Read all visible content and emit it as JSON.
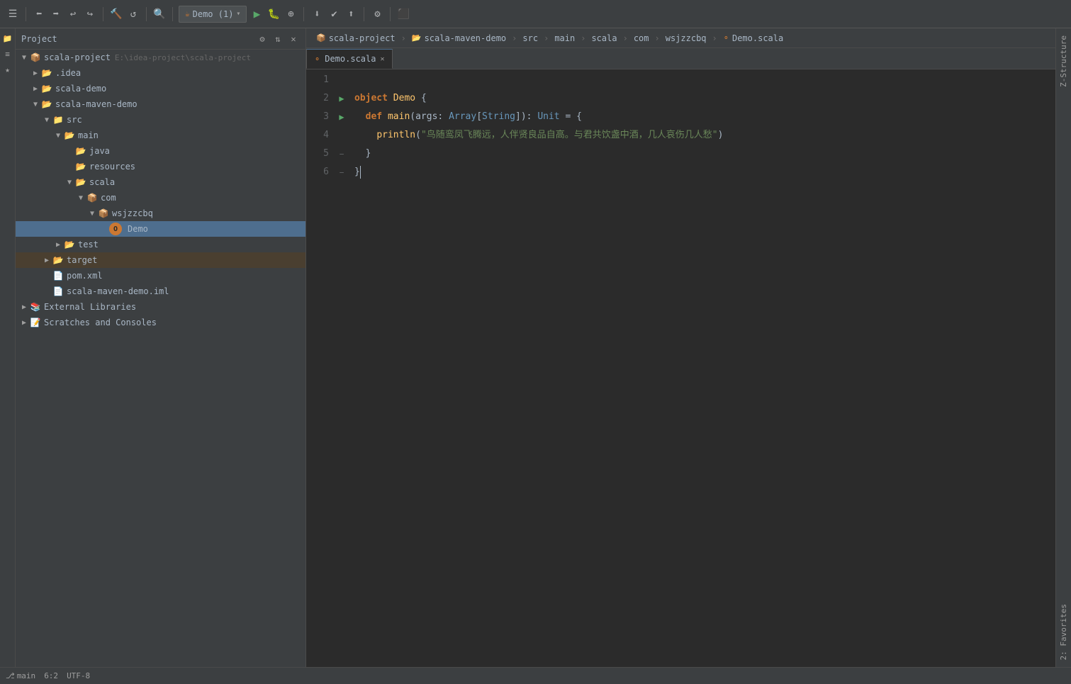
{
  "toolbar": {
    "run_config": "Demo (1)",
    "icons": [
      "☰",
      "⚲",
      "↺",
      "←",
      "→",
      "⊘",
      "✎",
      "⚡",
      "▶",
      "⬛",
      "⟳",
      "⚙",
      "⛃",
      "▷",
      "⚑"
    ],
    "run_label": "Demo (1)"
  },
  "breadcrumb": {
    "items": [
      "scala-project",
      "scala-maven-demo",
      "src",
      "main",
      "scala",
      "com",
      "wsjzzcbq",
      "Demo.scala"
    ]
  },
  "sidebar": {
    "title": "Project",
    "tree": [
      {
        "id": "scala-project",
        "label": "scala-project",
        "sublabel": "E:\\idea-project\\scala-project",
        "indent": 0,
        "type": "root",
        "expanded": true,
        "arrow": "▼"
      },
      {
        "id": "idea",
        "label": ".idea",
        "indent": 1,
        "type": "folder",
        "expanded": false,
        "arrow": "▶"
      },
      {
        "id": "scala-demo",
        "label": "scala-demo",
        "indent": 1,
        "type": "module",
        "expanded": false,
        "arrow": "▶"
      },
      {
        "id": "scala-maven-demo",
        "label": "scala-maven-demo",
        "indent": 1,
        "type": "module",
        "expanded": true,
        "arrow": "▼"
      },
      {
        "id": "src",
        "label": "src",
        "indent": 2,
        "type": "src-folder",
        "expanded": true,
        "arrow": "▼"
      },
      {
        "id": "main",
        "label": "main",
        "indent": 3,
        "type": "folder",
        "expanded": true,
        "arrow": "▼"
      },
      {
        "id": "java",
        "label": "java",
        "indent": 4,
        "type": "folder",
        "expanded": false,
        "arrow": ""
      },
      {
        "id": "resources",
        "label": "resources",
        "indent": 4,
        "type": "folder",
        "expanded": false,
        "arrow": ""
      },
      {
        "id": "scala",
        "label": "scala",
        "indent": 4,
        "type": "folder",
        "expanded": true,
        "arrow": "▼"
      },
      {
        "id": "com",
        "label": "com",
        "indent": 5,
        "type": "package",
        "expanded": true,
        "arrow": "▼"
      },
      {
        "id": "wsjzzcbq",
        "label": "wsjzzcbq",
        "indent": 6,
        "type": "package",
        "expanded": true,
        "arrow": "▼"
      },
      {
        "id": "Demo",
        "label": "Demo",
        "indent": 7,
        "type": "scala-class",
        "selected": true
      },
      {
        "id": "test",
        "label": "test",
        "indent": 3,
        "type": "folder",
        "expanded": false,
        "arrow": "▶"
      },
      {
        "id": "target",
        "label": "target",
        "indent": 2,
        "type": "folder",
        "expanded": false,
        "arrow": "▶"
      },
      {
        "id": "pom.xml",
        "label": "pom.xml",
        "indent": 2,
        "type": "xml"
      },
      {
        "id": "scala-maven-demo.iml",
        "label": "scala-maven-demo.iml",
        "indent": 2,
        "type": "iml"
      },
      {
        "id": "external-libraries",
        "label": "External Libraries",
        "indent": 0,
        "type": "libs",
        "expanded": false,
        "arrow": "▶"
      },
      {
        "id": "scratches",
        "label": "Scratches and Consoles",
        "indent": 0,
        "type": "scratches",
        "expanded": false,
        "arrow": "▶"
      }
    ]
  },
  "editor": {
    "active_tab": "Demo.scala",
    "tabs": [
      {
        "label": "Demo.scala",
        "active": true
      }
    ],
    "lines": [
      {
        "num": 1,
        "content": "",
        "gutter": ""
      },
      {
        "num": 2,
        "content": "object Demo {",
        "gutter": "run"
      },
      {
        "num": 3,
        "content": "  def main(args: Array[String]): Unit = {",
        "gutter": "run"
      },
      {
        "num": 4,
        "content": "    println(\"鸟随鸾凤飞腾远，人伴贤良品自高。与君共饮盏中酒，几人哀伤几人愁\")",
        "gutter": ""
      },
      {
        "num": 5,
        "content": "  }",
        "gutter": "fold"
      },
      {
        "num": 6,
        "content": "}",
        "gutter": "fold"
      }
    ],
    "code": {
      "line2_obj": "object",
      "line2_name": "Demo",
      "line3_def": "def",
      "line3_main": "main",
      "line3_args": "args",
      "line3_colon": ": ",
      "line3_array": "Array",
      "line3_string": "String",
      "line3_unit": "Unit",
      "line4_println": "println",
      "line4_string": "\"鸟随鸾凤飞腾远，人伴贤良品自高。与君共饮盏中酒，几人哀伤几人愁\""
    }
  },
  "status_bar": {
    "encoding": "UTF-8",
    "line_col": "6:2",
    "git": "main"
  },
  "left_panel": {
    "icons": [
      "📁",
      "🔍",
      "⚙"
    ]
  },
  "vertical_panels": {
    "structure": "Z-Structure",
    "favorites": "2: Favorites"
  },
  "cursor_position": {
    "line": 6,
    "col": 2
  }
}
